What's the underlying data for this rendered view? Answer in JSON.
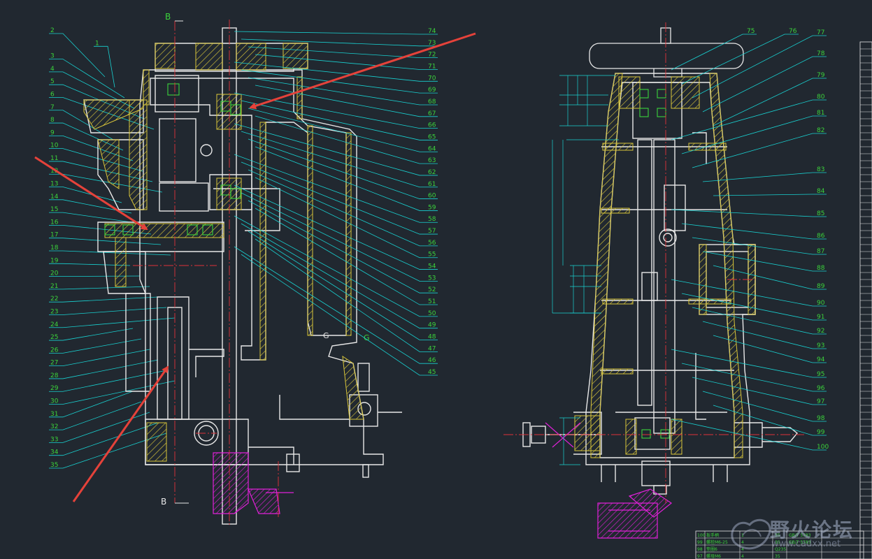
{
  "drawing": {
    "section_label_top": "B",
    "section_label_bottom": "B",
    "section_mark_g_left": "G",
    "section_mark_g_right": "G"
  },
  "left_callouts": [
    "2",
    "1",
    "3",
    "4",
    "5",
    "6",
    "7",
    "8",
    "9",
    "10",
    "11",
    "12",
    "13",
    "14",
    "15",
    "16",
    "17",
    "18",
    "19",
    "20",
    "21",
    "22",
    "23",
    "24",
    "25",
    "26",
    "27",
    "28",
    "29",
    "30",
    "31",
    "32",
    "33",
    "34",
    "35"
  ],
  "middle_callouts": [
    "74",
    "73",
    "72",
    "71",
    "70",
    "69",
    "68",
    "67",
    "66",
    "65",
    "64",
    "63",
    "62",
    "61",
    "60",
    "59",
    "58",
    "57",
    "56",
    "55",
    "54",
    "53",
    "52",
    "51",
    "50",
    "49",
    "48",
    "47",
    "46",
    "45"
  ],
  "right_callouts": [
    "75",
    "76",
    "77",
    "78",
    "79",
    "80",
    "81",
    "82",
    "83",
    "84",
    "85",
    "86",
    "87",
    "88",
    "89",
    "90",
    "91",
    "92",
    "93",
    "94",
    "95",
    "96",
    "97",
    "98",
    "99",
    "100"
  ],
  "parts_table": {
    "rows": [
      [
        "100",
        "扳手柄",
        "1",
        "35",
        "GB/T 5783"
      ],
      [
        "99",
        "螺栓M6-25",
        "4",
        "35",
        "GB/T 5783"
      ],
      [
        "98",
        "垫圈6",
        "4",
        "Q235",
        ""
      ],
      [
        "97",
        "螺母M6",
        "4",
        "35",
        ""
      ]
    ]
  },
  "watermark": {
    "text": "野火论坛",
    "sub": "www.cadxx.net"
  },
  "colors": {
    "background": "#212830",
    "outline": "#e8e8e8",
    "hatch": "#d7c43a",
    "leader": "#19d1d1",
    "callout_text": "#3bd43b",
    "center_line": "#e0323a",
    "magenta": "#e020d8",
    "arrow": "#e5423a"
  }
}
